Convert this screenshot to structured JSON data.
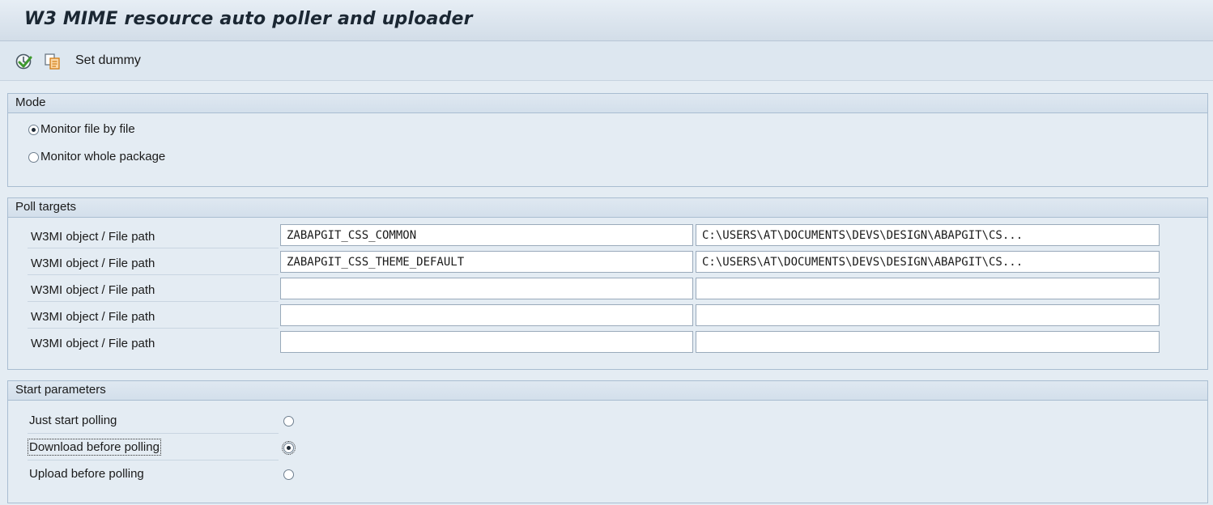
{
  "title": "W3 MIME resource auto poller and uploader",
  "toolbar": {
    "items": [
      {
        "icon": "execute-icon"
      },
      {
        "icon": "copy-variant-icon"
      }
    ],
    "set_dummy_label": "Set dummy"
  },
  "mode": {
    "header": "Mode",
    "options": [
      {
        "label": "Monitor file by file",
        "selected": true
      },
      {
        "label": "Monitor whole package",
        "selected": false
      }
    ]
  },
  "poll_targets": {
    "header": "Poll targets",
    "rows": [
      {
        "label": "W3MI object / File path",
        "object": "ZABAPGIT_CSS_COMMON",
        "path": "C:\\USERS\\AT\\DOCUMENTS\\DEVS\\DESIGN\\ABAPGIT\\CS..."
      },
      {
        "label": "W3MI object / File path",
        "object": "ZABAPGIT_CSS_THEME_DEFAULT",
        "path": "C:\\USERS\\AT\\DOCUMENTS\\DEVS\\DESIGN\\ABAPGIT\\CS..."
      },
      {
        "label": "W3MI object / File path",
        "object": "",
        "path": ""
      },
      {
        "label": "W3MI object / File path",
        "object": "",
        "path": ""
      },
      {
        "label": "W3MI object / File path",
        "object": "",
        "path": ""
      }
    ]
  },
  "start_parameters": {
    "header": "Start parameters",
    "options": [
      {
        "label": "Just start polling",
        "selected": false
      },
      {
        "label": "Download before polling",
        "selected": true
      },
      {
        "label": "Upload before polling",
        "selected": false
      }
    ]
  },
  "colors": {
    "background": "#e4ecf3",
    "header": "#d3dfeb",
    "border": "#a9bdd1"
  }
}
